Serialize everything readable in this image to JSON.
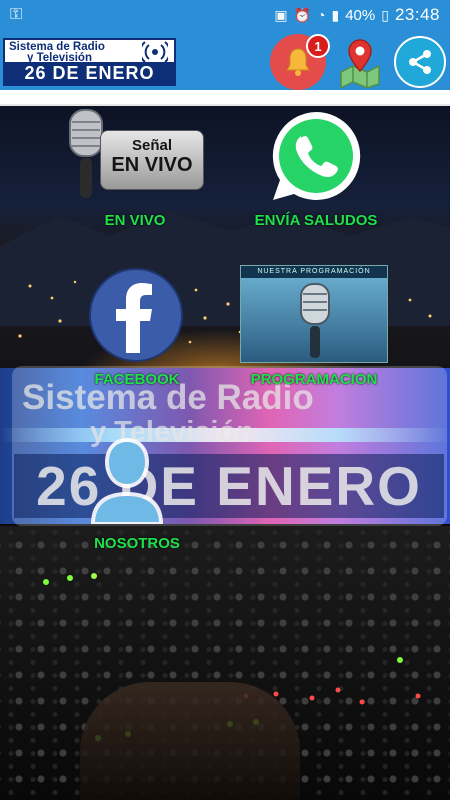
{
  "status_bar": {
    "battery": "40%",
    "time": "23:48"
  },
  "app_bar": {
    "logo_line1": "Sistema de Radio",
    "logo_line2": "y Televisión",
    "logo_line3": "26 DE ENERO",
    "notification_count": "1"
  },
  "menu": {
    "envivo_sign_line1": "Señal",
    "envivo_sign_line2": "EN VIVO",
    "envivo": "EN VIVO",
    "saludos": "ENVÍA SALUDOS",
    "facebook": "FACEBOOK",
    "programacion_banner": "NUESTRA PROGRAMACIÓN",
    "programacion": "PROGRAMACION",
    "nosotros": "NOSOTROS"
  },
  "watermark": {
    "line1": "Sistema de Radio",
    "line2": "y Televisión",
    "line3": "26 DE ENERO"
  },
  "colors": {
    "bar": "#2a8fd6",
    "label": "#1fe14a",
    "bell": "#e44b4b",
    "share": "#1fa8d8"
  }
}
